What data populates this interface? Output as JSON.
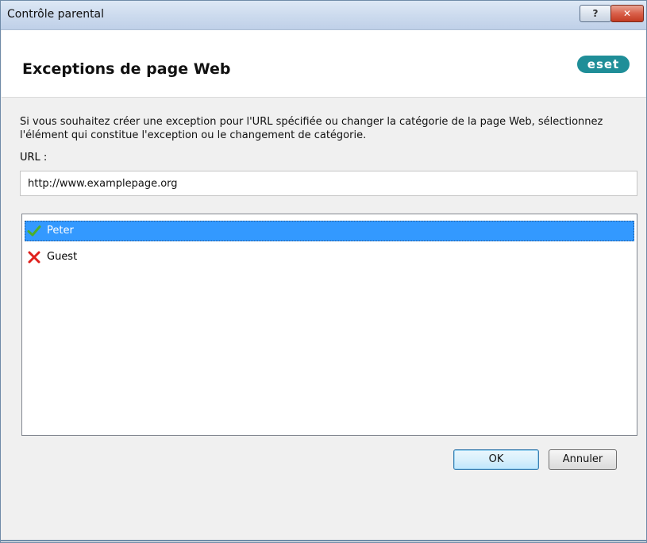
{
  "window": {
    "title": "Contrôle parental",
    "help_button": "?",
    "close_button": "✕"
  },
  "header": {
    "heading": "Exceptions de page Web",
    "logo": "eset"
  },
  "content": {
    "description": "Si vous souhaitez créer une exception pour l'URL spécifiée ou changer la catégorie de la page Web, sélectionnez l'élément qui constitue l'exception ou le changement de catégorie.",
    "url_label": "URL :",
    "url_value": "http://www.examplepage.org"
  },
  "users": [
    {
      "name": "Peter",
      "status": "allowed",
      "icon": "check-icon",
      "selected": true
    },
    {
      "name": "Guest",
      "status": "blocked",
      "icon": "cross-icon",
      "selected": false
    }
  ],
  "buttons": {
    "ok": "OK",
    "cancel": "Annuler"
  },
  "colors": {
    "selection": "#3399ff",
    "check": "#4caf2a",
    "cross": "#e0201c",
    "logo": "#1f8e98"
  }
}
